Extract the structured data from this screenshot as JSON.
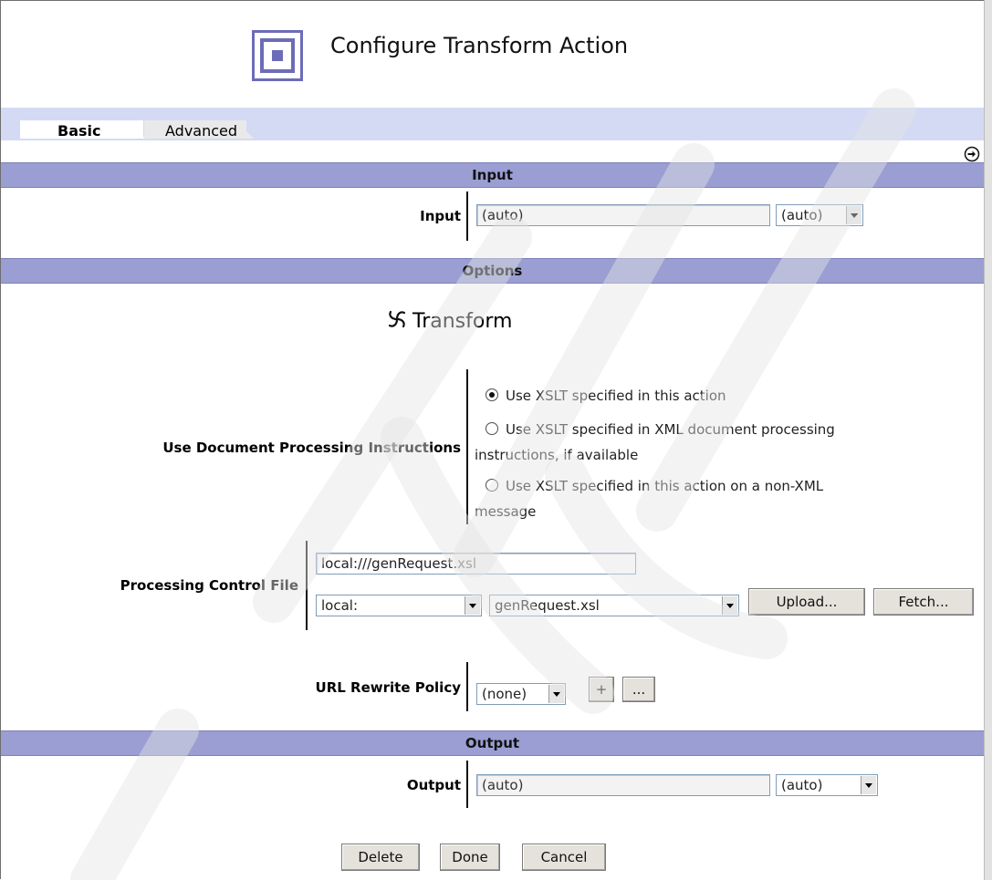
{
  "page": {
    "title": "Configure Transform Action"
  },
  "tabs": [
    {
      "label": "Basic",
      "active": true
    },
    {
      "label": "Advanced",
      "active": false
    }
  ],
  "icons": {
    "header": "action-square-icon",
    "nav": "arrow-right-circle-icon",
    "transform": "transform-swirl-icon"
  },
  "sections": {
    "input": "Input",
    "options": "Options",
    "output": "Output"
  },
  "input": {
    "label": "Input",
    "value": "(auto)",
    "select": "(auto)"
  },
  "options": {
    "heading": "Transform",
    "doc_processing": {
      "label": "Use Document Processing Instructions",
      "choices": [
        {
          "line1": "Use XSLT specified in this action",
          "line2": "",
          "selected": true
        },
        {
          "line1": "Use XSLT specified in XML document processing",
          "line2": "instructions, if available",
          "selected": false
        },
        {
          "line1": "Use XSLT specified in this action on a non-XML",
          "line2": "message",
          "selected": false
        }
      ]
    },
    "control_file": {
      "label": "Processing Control File",
      "value": "local:///genRequest.xsl",
      "location": "local:",
      "file": "genRequest.xsl",
      "upload_label": "Upload...",
      "fetch_label": "Fetch..."
    },
    "url_rewrite": {
      "label": "URL Rewrite Policy",
      "select": "(none)",
      "add_label": "+",
      "more_label": "..."
    }
  },
  "output": {
    "label": "Output",
    "value": "(auto)",
    "select": "(auto)"
  },
  "actions": {
    "delete": "Delete",
    "done": "Done",
    "cancel": "Cancel"
  },
  "colors": {
    "section_bar": "#9a9ed2",
    "tab_bar": "#d4daf4",
    "icon_accent": "#6c6cb8"
  }
}
